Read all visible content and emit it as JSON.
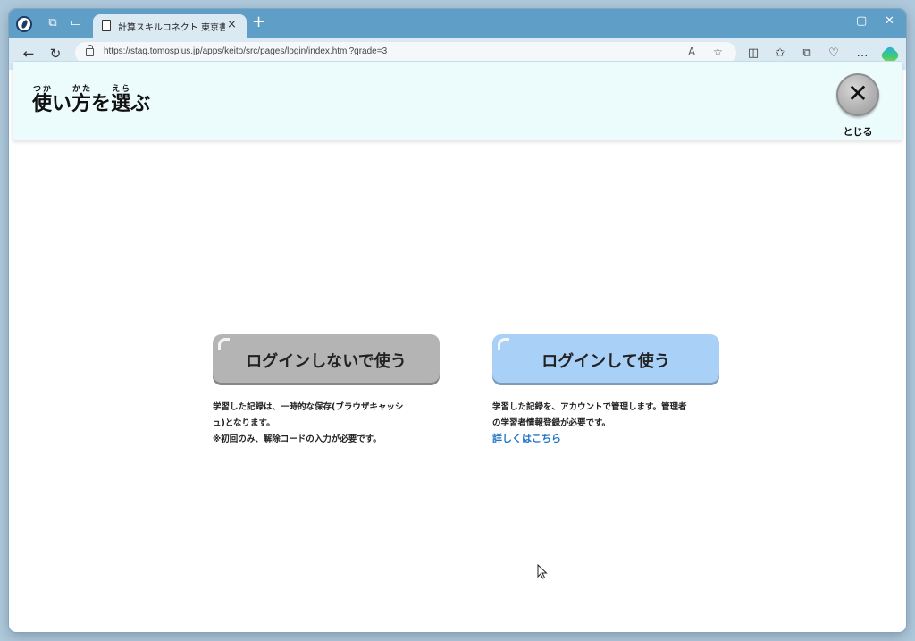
{
  "browser": {
    "tab_title": "計算スキルコネクト 東京書籍版",
    "tab_close": "×",
    "new_tab": "+",
    "url": "https://stag.tomosplus.jp/apps/keito/src/pages/login/index.html?grade=3",
    "window_controls": [
      "–",
      "▢",
      "✕"
    ]
  },
  "header": {
    "title_parts": [
      {
        "base": "使",
        "ruby": "つか"
      },
      {
        "plain": "い"
      },
      {
        "base": "方",
        "ruby": "かた"
      },
      {
        "plain": "を"
      },
      {
        "base": "選",
        "ruby": "えら"
      },
      {
        "plain": "ぶ"
      }
    ],
    "close_label": "とじる",
    "close_symbol": "✕"
  },
  "options": {
    "guest": {
      "label": "ログインしないで使う",
      "desc_line1": "学習した記録は、一時的な保存(ブラウザキャッシ",
      "desc_line2": "ュ)となります。",
      "desc_line3": "※初回のみ、解除コードの入力が必要です。"
    },
    "login": {
      "label": "ログインして使う",
      "desc_line1": "学習した記録を、アカウントで管理します。管理者",
      "desc_line2": "の学習者情報登録が必要です。",
      "link": "詳しくはこちら"
    }
  },
  "colors": {
    "header_bg": "#ecfcfd",
    "guest_button": "#b4b4b4",
    "login_button": "#a9d0f7",
    "link": "#2477c8",
    "titlebar": "#5f9ec6"
  }
}
